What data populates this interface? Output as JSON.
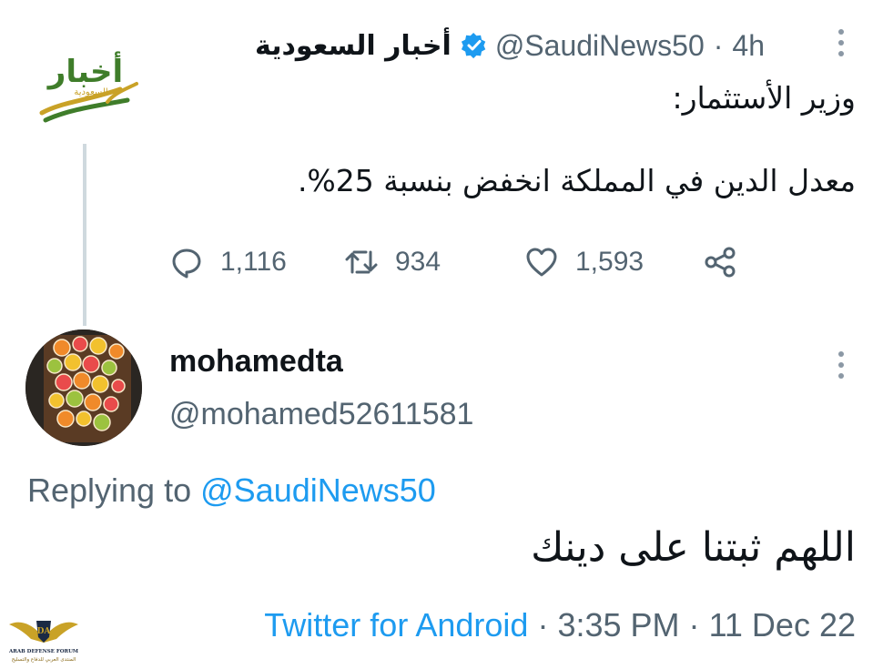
{
  "tweet": {
    "display_name": "أخبار السعودية",
    "handle": "@SaudiNews50",
    "separator": "·",
    "time": "4h",
    "avatar_text": "أخبار",
    "avatar_subtext": "السعودية",
    "text_line1": "وزير الأستثمار:",
    "text_line2": "معدل الدين في المملكة انخفض بنسبة 25%.",
    "reply_count": "1,116",
    "retweet_count": "934",
    "like_count": "1,593"
  },
  "reply": {
    "display_name": "mohamedta",
    "handle": "@mohamed52611581",
    "replying_prefix": "Replying to",
    "replying_mention": "@SaudiNews50",
    "text": "اللهم ثبتنا على دينك",
    "source": "Twitter for Android",
    "separator1": "·",
    "time": "3:35 PM",
    "separator2": "·",
    "date": "11 Dec 22"
  },
  "watermark": {
    "logo_text": "DA",
    "line1": "ARAB DEFENSE FORUM",
    "line2": "المنتدى العربي للدفاع والتسليح"
  },
  "colors": {
    "accent": "#1d9bf0",
    "secondary_text": "#536471",
    "primary_text": "#0f1419",
    "logo_green": "#3f7d2a",
    "logo_gold": "#c9a227"
  },
  "icons": {
    "verified": "verified-badge-icon",
    "reply": "speech-bubble-icon",
    "retweet": "retweet-arrows-icon",
    "like": "heart-icon",
    "share": "share-nodes-icon",
    "more": "vertical-dots-icon"
  }
}
